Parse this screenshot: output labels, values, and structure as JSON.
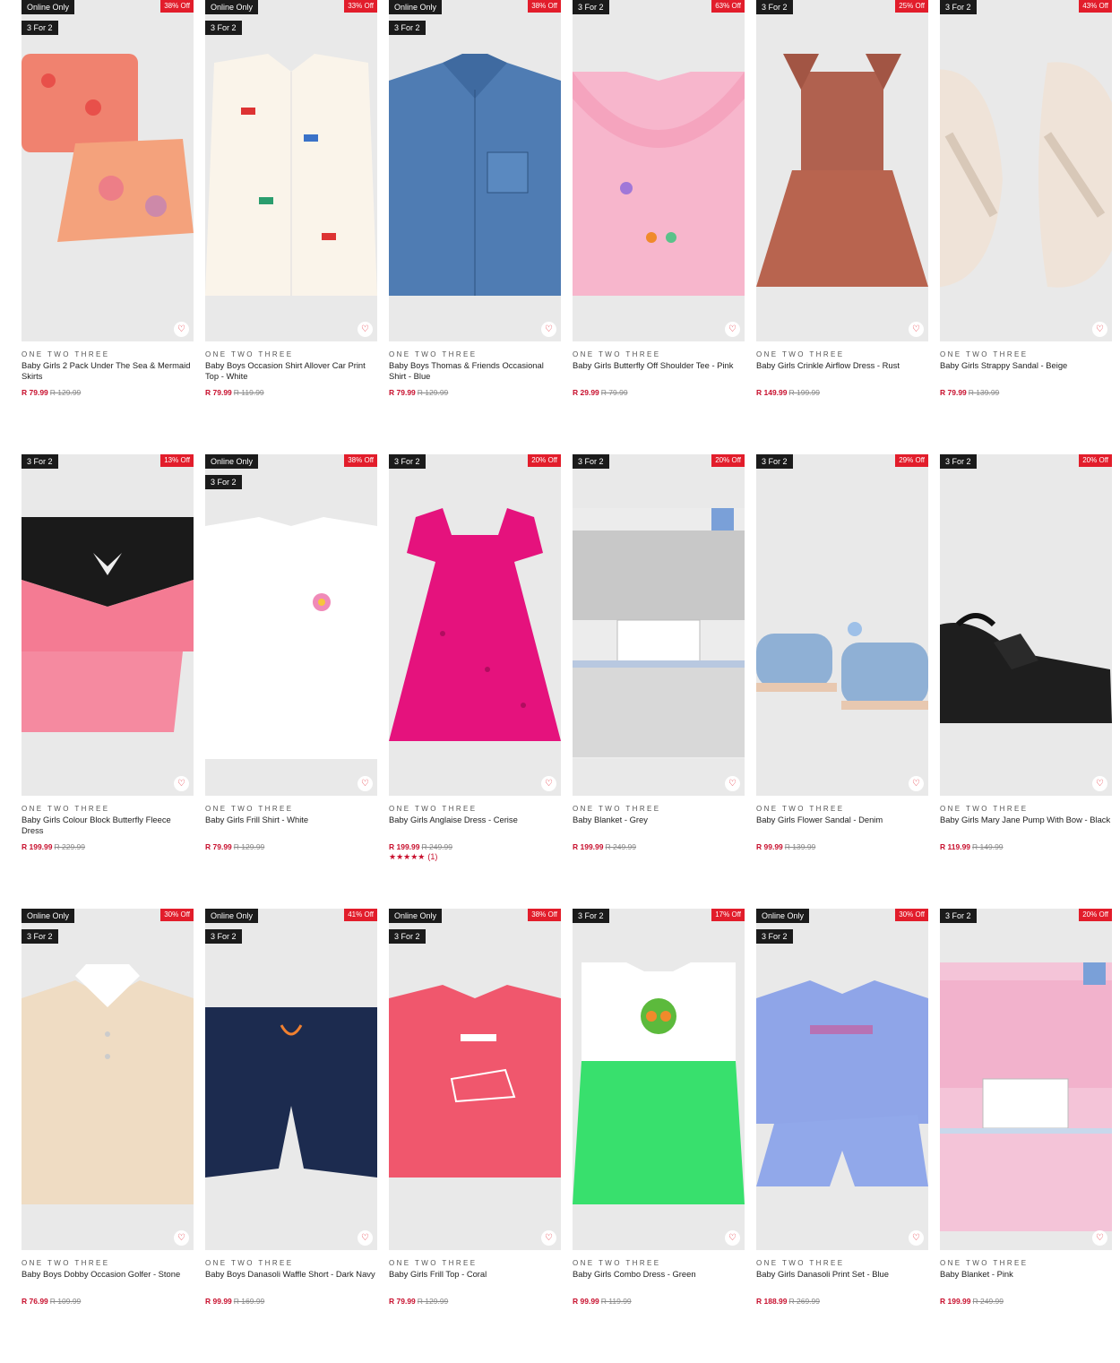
{
  "colors": {
    "sale_red": "#e21d2b",
    "price_red": "#c8102e",
    "badge_black": "#1b1b1b",
    "image_bg": "#e9e9e9"
  },
  "products": [
    {
      "badges": [
        "Online Only",
        "3 For 2"
      ],
      "discount": "38% Off",
      "brand": "ONE TWO THREE",
      "name": "Baby Girls 2 Pack Under The Sea & Mermaid Skirts",
      "price": "R 79.99",
      "was": "R 129.99",
      "art": "skirts"
    },
    {
      "badges": [
        "Online Only",
        "3 For 2"
      ],
      "discount": "33% Off",
      "brand": "ONE TWO THREE",
      "name": "Baby Boys Occasion Shirt Allover Car Print Top - White",
      "price": "R 79.99",
      "was": "R 119.99",
      "art": "shirt-white"
    },
    {
      "badges": [
        "Online Only",
        "3 For 2"
      ],
      "discount": "38% Off",
      "brand": "ONE TWO THREE",
      "name": "Baby Boys Thomas & Friends Occasional Shirt - Blue",
      "price": "R 79.99",
      "was": "R 129.99",
      "art": "shirt-denim"
    },
    {
      "badges": [
        "3 For 2"
      ],
      "discount": "63% Off",
      "brand": "ONE TWO THREE",
      "name": "Baby Girls Butterfly Off Shoulder Tee - Pink",
      "price": "R 29.99",
      "was": "R 79.99",
      "art": "tee-pink"
    },
    {
      "badges": [
        "3 For 2"
      ],
      "discount": "25% Off",
      "brand": "ONE TWO THREE",
      "name": "Baby Girls Crinkle Airflow Dress - Rust",
      "price": "R 149.99",
      "was": "R 199.99",
      "art": "dress-rust"
    },
    {
      "badges": [
        "3 For 2"
      ],
      "discount": "43% Off",
      "brand": "ONE TWO THREE",
      "name": "Baby Girls Strappy Sandal - Beige",
      "price": "R 79.99",
      "was": "R 139.99",
      "art": "sandal-beige"
    },
    {
      "badges": [
        "3 For 2"
      ],
      "discount": "13% Off",
      "brand": "ONE TWO THREE",
      "name": "Baby Girls Colour Block Butterfly Fleece Dress",
      "price": "R 199.99",
      "was": "R 229.99",
      "art": "dress-colourblock"
    },
    {
      "badges": [
        "Online Only",
        "3 For 2"
      ],
      "discount": "38% Off",
      "brand": "ONE TWO THREE",
      "name": "Baby Girls Frill Shirt - White",
      "price": "R 79.99",
      "was": "R 129.99",
      "art": "frill-white"
    },
    {
      "badges": [
        "3 For 2"
      ],
      "discount": "20% Off",
      "brand": "ONE TWO THREE",
      "name": "Baby Girls Anglaise Dress - Cerise",
      "price": "R 199.99",
      "was": "R 249.99",
      "rating": "★★★★★",
      "reviews": "(1)",
      "art": "dress-cerise"
    },
    {
      "badges": [
        "3 For 2"
      ],
      "discount": "20% Off",
      "brand": "ONE TWO THREE",
      "name": "Baby Blanket - Grey",
      "price": "R 199.99",
      "was": "R 249.99",
      "art": "blanket-grey"
    },
    {
      "badges": [
        "3 For 2"
      ],
      "discount": "29% Off",
      "brand": "ONE TWO THREE",
      "name": "Baby Girls Flower Sandal - Denim",
      "price": "R 99.99",
      "was": "R 139.99",
      "art": "sandal-denim"
    },
    {
      "badges": [
        "3 For 2"
      ],
      "discount": "20% Off",
      "brand": "ONE TWO THREE",
      "name": "Baby Girls Mary Jane Pump With Bow - Black",
      "price": "R 119.99",
      "was": "R 149.99",
      "art": "pump-black"
    },
    {
      "badges": [
        "Online Only",
        "3 For 2"
      ],
      "discount": "30% Off",
      "brand": "ONE TWO THREE",
      "name": "Baby Boys Dobby Occasion Golfer - Stone",
      "price": "R 76.99",
      "was": "R 109.99",
      "art": "golfer-stone"
    },
    {
      "badges": [
        "Online Only",
        "3 For 2"
      ],
      "discount": "41% Off",
      "brand": "ONE TWO THREE",
      "name": "Baby Boys Danasoli Waffle Short - Dark Navy",
      "price": "R 99.99",
      "was": "R 169.99",
      "art": "short-navy"
    },
    {
      "badges": [
        "Online Only",
        "3 For 2"
      ],
      "discount": "38% Off",
      "brand": "ONE TWO THREE",
      "name": "Baby Girls Frill Top - Coral",
      "price": "R 79.99",
      "was": "R 129.99",
      "art": "top-coral"
    },
    {
      "badges": [
        "3 For 2"
      ],
      "discount": "17% Off",
      "brand": "ONE TWO THREE",
      "name": "Baby Girls Combo Dress - Green",
      "price": "R 99.99",
      "was": "R 119.99",
      "art": "dress-green"
    },
    {
      "badges": [
        "Online Only",
        "3 For 2"
      ],
      "discount": "30% Off",
      "brand": "ONE TWO THREE",
      "name": "Baby Girls Danasoli Print Set - Blue",
      "price": "R 188.99",
      "was": "R 269.99",
      "art": "set-blue"
    },
    {
      "badges": [
        "3 For 2"
      ],
      "discount": "20% Off",
      "brand": "ONE TWO THREE",
      "name": "Baby Blanket - Pink",
      "price": "R 199.99",
      "was": "R 249.99",
      "art": "blanket-pink"
    }
  ]
}
